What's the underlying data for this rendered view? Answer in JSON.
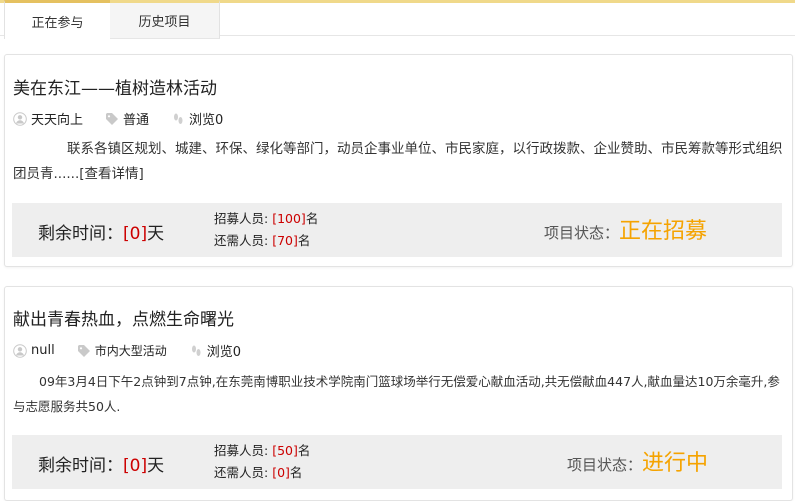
{
  "tabs": [
    {
      "label": "正在参与"
    },
    {
      "label": "历史项目"
    }
  ],
  "projects": [
    {
      "title": "美在东江——植树造林活动",
      "author": "天天向上",
      "category": "普通",
      "views": "浏览0",
      "description": "联系各镇区规划、城建、环保、绿化等部门，动员企事业单位、市民家庭，以行政拨款、企业赞助、市民筹款等形式组织团员青......",
      "detail_link": "[查看详情]",
      "remaining_label": "剩余时间：",
      "remaining_value": "[0]",
      "remaining_unit": "天",
      "recruit_label": "招募人员: ",
      "recruit_value": "[100]",
      "recruit_unit": "名",
      "needed_label": "还需人员: ",
      "needed_value": "[70]",
      "needed_unit": "名",
      "status_label": "项目状态：",
      "status_value": "正在招募"
    },
    {
      "title": "献出青春热血，点燃生命曙光",
      "author": "null",
      "category": "市内大型活动",
      "views": "浏览0",
      "description": "09年3月4日下午2点钟到7点钟,在东莞南博职业技术学院南门篮球场举行无偿爱心献血活动,共无偿献血447人,献血量达10万余毫升,参与志愿服务共50人.",
      "remaining_label": "剩余时间：",
      "remaining_value": "[0]",
      "remaining_unit": "天",
      "recruit_label": "招募人员: ",
      "recruit_value": "[50]",
      "recruit_unit": "名",
      "needed_label": "还需人员: ",
      "needed_value": "[0]",
      "needed_unit": "名",
      "status_label": "项目状态：",
      "status_value": "进行中"
    }
  ],
  "colors": {
    "accent": "#f5a300",
    "count_red": "#cc0000",
    "tab_border": "#e5c160"
  },
  "icons": [
    "user-icon",
    "tag-icon",
    "footprint-icon"
  ]
}
